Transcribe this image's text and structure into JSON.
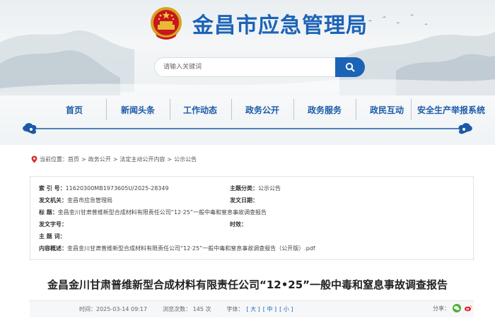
{
  "header": {
    "site_title": "金昌市应急管理局",
    "search_placeholder": "请输入关键词"
  },
  "nav": {
    "items": [
      {
        "label": "首页"
      },
      {
        "label": "新闻头条"
      },
      {
        "label": "工作动态"
      },
      {
        "label": "政务公开"
      },
      {
        "label": "政务服务"
      },
      {
        "label": "政民互动"
      },
      {
        "label": "安全生产举报系统"
      }
    ]
  },
  "breadcrumb": {
    "label": "当前位置：",
    "items": [
      "首页",
      "政务公开",
      "法定主动公开内容",
      "公示公告"
    ],
    "sep": ">"
  },
  "info": {
    "index_label": "索  引  号：",
    "index_value": "11620300MB1973605U/2025-28349",
    "category_label": "主题分类：",
    "category_value": "公示公告",
    "issuer_label": "发文机关：",
    "issuer_value": "金昌市应急管理局",
    "date_label": "发文日期：",
    "date_value": "",
    "title_label": "标      题：",
    "title_value": "金昌金川甘肃普维新型合成材料有限责任公司“12·25”一般中毒和窒息事故调查报告",
    "docno_label": "发文字号：",
    "docno_value": "",
    "validity_label": "时效：",
    "validity_value": "",
    "keywords_label": "主  题  词：",
    "keywords_value": "",
    "summary_label": "内容概述：",
    "summary_value": "金昌金川甘肃普维新型合成材料有限责任公司“12·25”一般中毒和窒息事故调查报告（公开版）.pdf"
  },
  "article": {
    "title": "金昌金川甘肃普维新型合成材料有限责任公司“12•25”一般中毒和窒息事故调查报告",
    "time": "时间：2025-03-14 09:17",
    "views": "浏览次数：  145 次",
    "font_label": "字体：",
    "font_large": "[ 大 ]",
    "font_medium": "[ 中 ]",
    "font_small": "[ 小 ]",
    "share_label": "分享："
  },
  "colors": {
    "brand": "#1c63b7",
    "nav_text": "#1c5aa8"
  }
}
